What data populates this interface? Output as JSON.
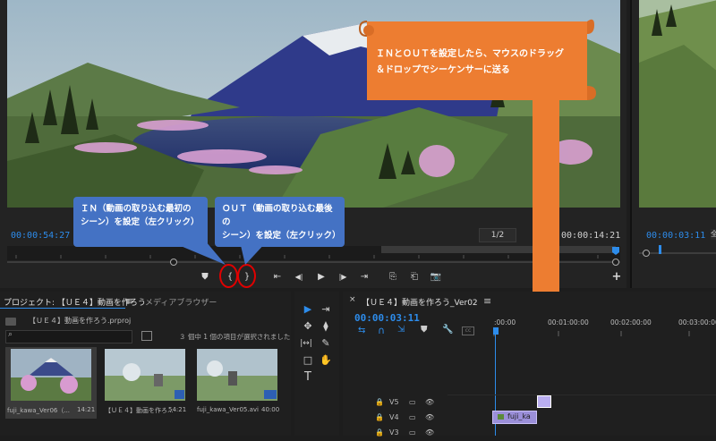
{
  "source_monitor": {
    "timecode_current": "00:00:54:27",
    "zoom_fraction": "1/2",
    "timecode_duration": "00:00:14:21",
    "controls": {
      "add_marker": "⛊",
      "mark_in": "{",
      "mark_out": "}",
      "go_to_in": "⇤",
      "step_back": "◀|",
      "play": "▶",
      "step_forward": "|▶",
      "go_to_out": "⇥",
      "insert": "⎘",
      "overwrite": "⎗",
      "export_frame": "📷",
      "add": "+"
    }
  },
  "program_monitor": {
    "timecode": "00:00:03:11",
    "fit_label": "全"
  },
  "callouts": {
    "in_line1": "ＩＮ（動画の取り込む最初の",
    "in_line2": "シーン）を設定（左クリック）",
    "out_line1": "ＯＵＴ（動画の取り込む最後の",
    "out_line2": "シーン）を設定（左クリック）",
    "banner_line1": "ＩＮとＯＵＴを設定したら、マウスのドラッグ",
    "banner_line2": "＆ドロップでシーケンサーに送る"
  },
  "project_panel": {
    "tab_project": "プロジェクト: 【ＵＥ４】動画を作ろう",
    "tab_menu": "≡",
    "tab_media": "メディアブラウザー",
    "project_file": "【ＵＥ４】動画を作ろう.prproj",
    "search_placeholder": "",
    "selection_status": "３ 個中 1 個の項目が選択されました",
    "items": [
      {
        "name": "fuji_kawa_Ver06（...",
        "duration": "14:21"
      },
      {
        "name": "【ＵＥ４】動画を作ろ...",
        "duration": "54:21"
      },
      {
        "name": "fuji_kawa_Ver05.avi",
        "duration": "40:00"
      }
    ]
  },
  "tools": [
    "▶",
    "⇥",
    "✥",
    "⧫",
    "|↔|",
    "✎",
    "□",
    "✋",
    "T"
  ],
  "timeline_panel": {
    "close": "×",
    "tab_title": "【ＵＥ４】動画を作ろう_Ver02",
    "tab_menu": "≡",
    "timecode": "00:00:03:11",
    "ruler": [
      ":00:00",
      "00:01:00:00",
      "00:02:00:00",
      "00:03:00:00"
    ],
    "tracks": [
      {
        "name": "V5"
      },
      {
        "name": "V4"
      },
      {
        "name": "V3"
      }
    ],
    "clip_label": "fuji_ka"
  },
  "colors": {
    "accent_blue": "#2d8ceb",
    "callout_blue": "#4472c4",
    "banner_orange": "#ed7d31",
    "clip_purple": "#9b8fd9"
  }
}
